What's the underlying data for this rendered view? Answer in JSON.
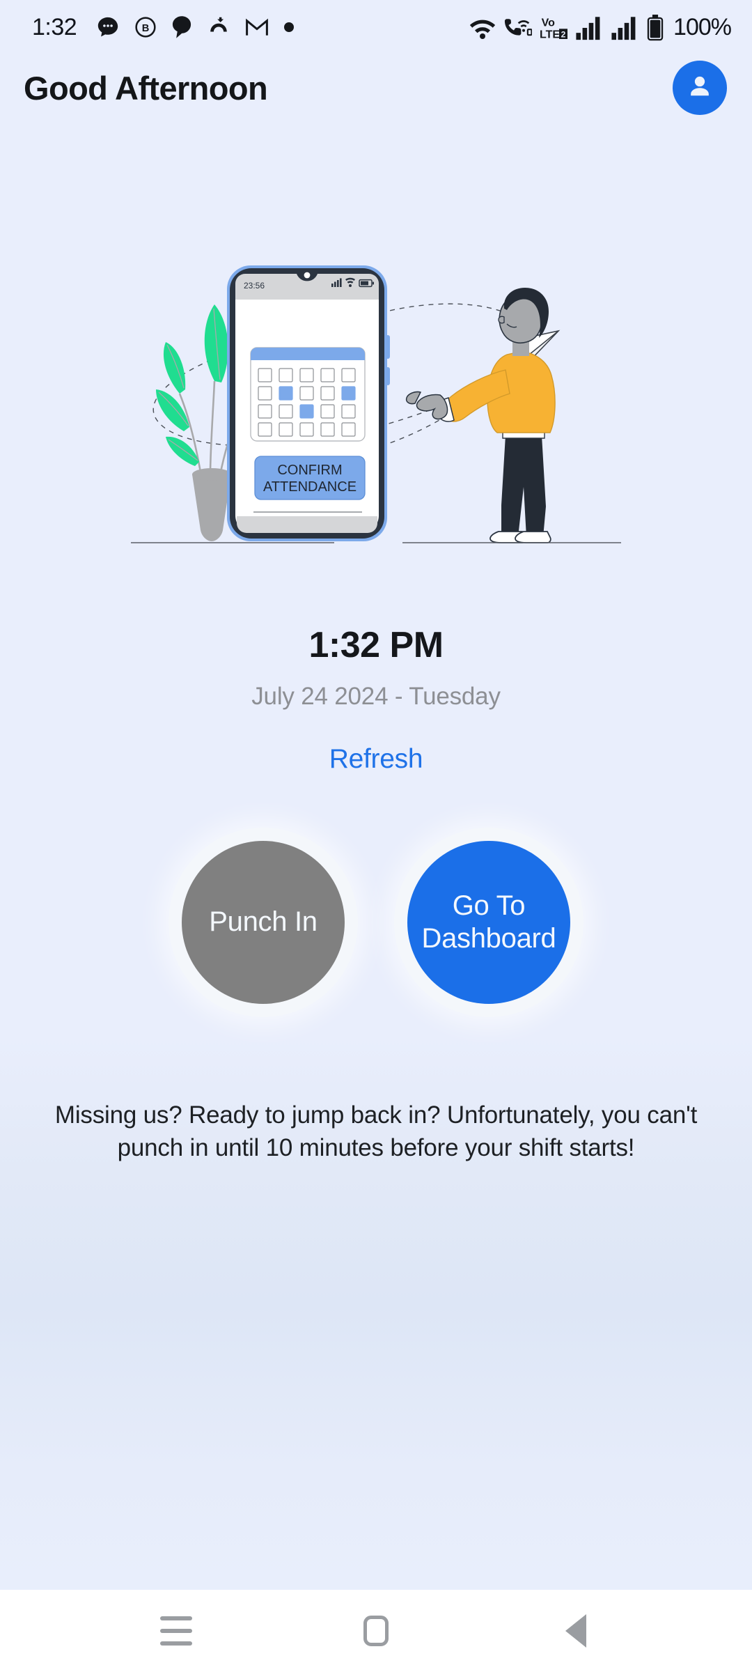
{
  "status_bar": {
    "clock": "1:32",
    "battery_text": "100%",
    "left_icons": [
      "chat-bubble-icon",
      "b-circle-icon",
      "speech-bubble-icon",
      "missed-call-icon",
      "gmail-icon",
      "dot-icon"
    ],
    "right_icons": [
      "wifi-icon",
      "wifi-calling-icon",
      "volte2-icon",
      "signal-bars-sim1-icon",
      "signal-bars-sim2-icon",
      "battery-full-icon"
    ]
  },
  "header": {
    "greeting": "Good Afternoon",
    "avatar_icon": "person-icon"
  },
  "illustration": {
    "name": "attendance-confirmation-illustration",
    "phone_status_time": "23:56",
    "button_label_line1": "CONFIRM",
    "button_label_line2": "ATTENDANCE",
    "calendar_highlighted_cells": [
      6,
      9,
      12
    ],
    "accent_blue": "#7ca9ea",
    "phone_frame": "#2b3440",
    "plant_green": "#20dd90",
    "shirt_orange": "#f7b233"
  },
  "clock_block": {
    "time": "1:32 PM",
    "date": "July 24 2024 - Tuesday",
    "refresh_label": "Refresh"
  },
  "actions": {
    "punch_in_label": "Punch In",
    "punch_in_color": "#808080",
    "punch_in_disabled": true,
    "dashboard_label_line1": "Go To",
    "dashboard_label_line2": "Dashboard",
    "dashboard_color": "#1b6fe8"
  },
  "notice": {
    "message": "Missing us? Ready to jump back in? Unfortunately, you can't punch in until 10 minutes before your shift starts!"
  },
  "nav_bar": {
    "recents_icon": "hamburger-recents-icon",
    "home_icon": "home-square-icon",
    "back_icon": "back-triangle-icon"
  },
  "theme": {
    "background": "#e8eefc",
    "accent": "#1b6fe8",
    "link": "#1f72e8",
    "muted_text": "#8d8f94"
  }
}
